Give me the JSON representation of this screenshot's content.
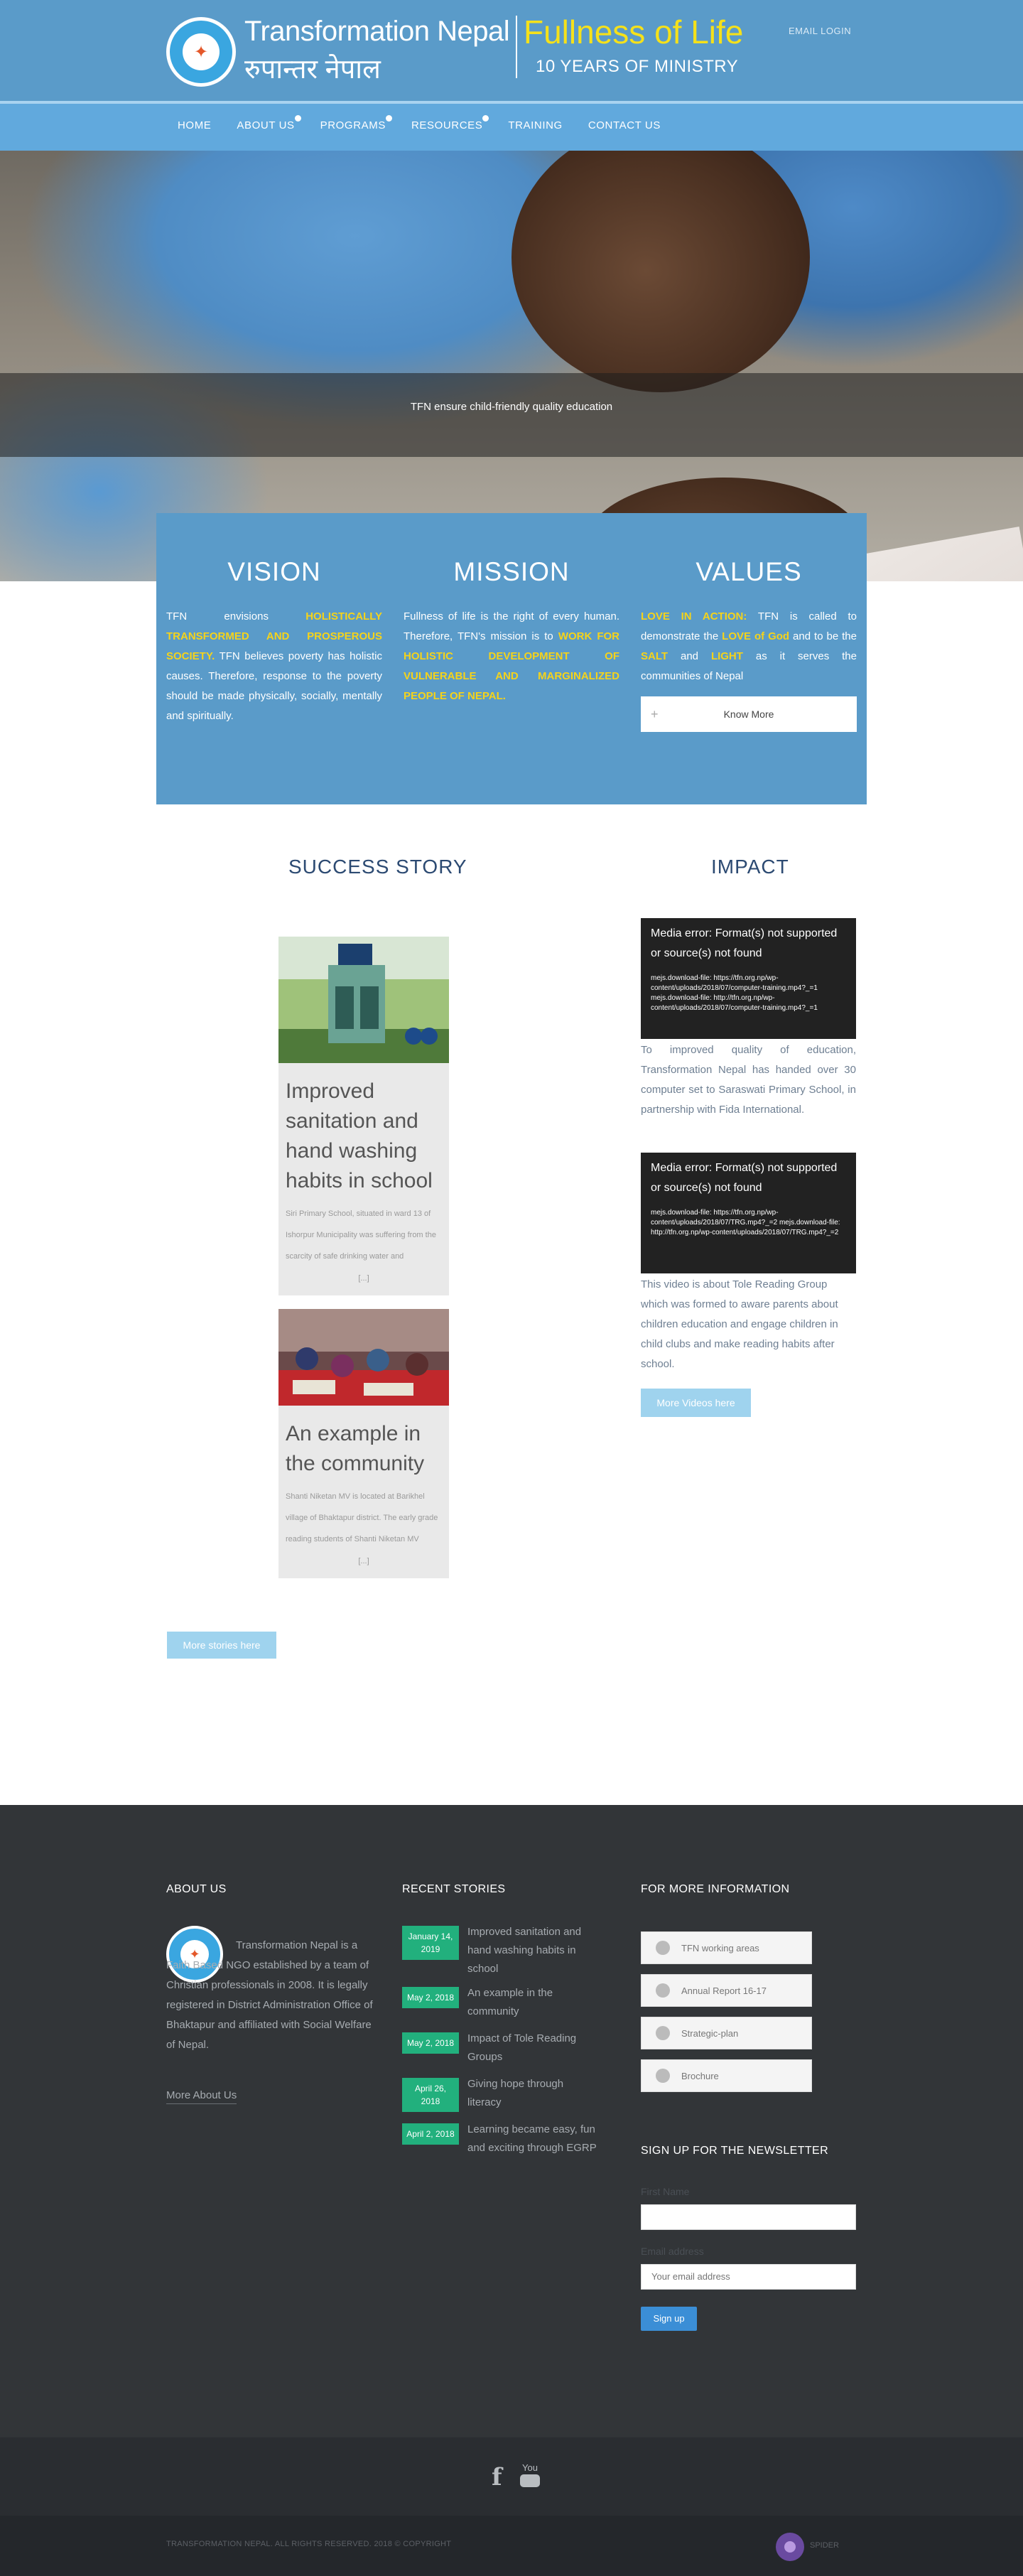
{
  "header": {
    "logo_text": "Transformation Nepal",
    "brand_name_en": "Transformation Nepal",
    "brand_name_np": "रुपान्तर नेपाल",
    "tagline": "Fullness of Life",
    "ministry": "10 YEARS OF MINISTRY",
    "email_login": "EMAIL LOGIN"
  },
  "nav": {
    "items": [
      {
        "label": "HOME"
      },
      {
        "label": "ABOUT US"
      },
      {
        "label": "PROGRAMS"
      },
      {
        "label": "RESOURCES"
      },
      {
        "label": "TRAINING"
      },
      {
        "label": "CONTACT US"
      }
    ]
  },
  "hero": {
    "caption": "TFN ensure child-friendly quality education"
  },
  "vmv": {
    "vision": {
      "title": "VISION",
      "t1": "TFN envisions ",
      "h1": "HOLISTICALLY TRANSFORMED AND PROSPEROUS SOCIETY.",
      "t2": " TFN believes poverty has holistic causes. Therefore, response to the poverty should be made physically, socially, mentally and spiritually."
    },
    "mission": {
      "title": "MISSION",
      "t1": "Fullness of life is the right of every human. Therefore, TFN's mission is to ",
      "h1": "WORK FOR HOLISTIC DEVELOPMENT OF VULNERABLE AND MARGINALIZED PEOPLE OF NEPAL."
    },
    "values": {
      "title": "VALUES",
      "h1": "LOVE IN ACTION:",
      "t1": " TFN is called to demonstrate the ",
      "h2": "LOVE of God",
      "t2": " and to be the ",
      "h3": "SALT",
      "t3": " and ",
      "h4": "LIGHT",
      "t4": " as it serves the communities of Nepal",
      "button": "Know More"
    }
  },
  "success": {
    "title": "SUCCESS STORY",
    "stories": [
      {
        "title": "Improved sanitation and hand washing habits in school",
        "excerpt": "Siri Primary School, situated in ward 13 of Ishorpur Municipality was suffering from the scarcity of safe drinking water and",
        "more": "[...]"
      },
      {
        "title": "An example in the community",
        "excerpt": "Shanti Niketan MV is located at Barikhel village of Bhaktapur district. The early grade reading students of Shanti Niketan MV",
        "more": "[...]"
      }
    ],
    "more_button": "More stories here"
  },
  "impact": {
    "title": "IMPACT",
    "videos": [
      {
        "error": "Media error: Format(s) not supported or source(s) not found",
        "detail": "mejs.download-file: https://tfn.org.np/wp-content/uploads/2018/07/computer-training.mp4?_=1 mejs.download-file: http://tfn.org.np/wp-content/uploads/2018/07/computer-training.mp4?_=1",
        "desc": "To improved quality of education, Transformation Nepal has handed over 30 computer set to Saraswati Primary School, in partnership with Fida International."
      },
      {
        "error": "Media error: Format(s) not supported or source(s) not found",
        "detail": "mejs.download-file: https://tfn.org.np/wp-content/uploads/2018/07/TRG.mp4?_=2 mejs.download-file: http://tfn.org.np/wp-content/uploads/2018/07/TRG.mp4?_=2",
        "desc": "This video is about Tole Reading Group which was formed to aware parents about children education and engage children in child clubs and make reading habits after school."
      }
    ],
    "more_button": "More Videos here"
  },
  "footer": {
    "about": {
      "title": "ABOUT US",
      "text": "Transformation Nepal is a Faith Based NGO established by a team of Christian professionals in 2008. It is legally registered in District Administration Office of Bhaktapur and affiliated with Social Welfare of Nepal.",
      "link": "More About Us"
    },
    "recent": {
      "title": "RECENT STORIES",
      "items": [
        {
          "date": "January 14, 2019",
          "title": "Improved sanitation and hand washing habits in school"
        },
        {
          "date": "May 2, 2018",
          "title": "An example in the community"
        },
        {
          "date": "May 2, 2018",
          "title": "Impact of Tole Reading Groups"
        },
        {
          "date": "April 26, 2018",
          "title": "Giving hope through literacy"
        },
        {
          "date": "April 2, 2018",
          "title": "Learning became easy, fun and exciting through EGRP"
        }
      ]
    },
    "info": {
      "title": "FOR MORE INFORMATION",
      "buttons": [
        {
          "label": "TFN working areas"
        },
        {
          "label": "Annual Report 16-17"
        },
        {
          "label": "Strategic-plan"
        },
        {
          "label": "Brochure"
        }
      ]
    },
    "newsletter": {
      "title": "SIGN UP FOR THE NEWSLETTER",
      "first_name_label": "First Name",
      "email_label": "Email address",
      "email_placeholder": "Your email address",
      "button": "Sign up"
    }
  },
  "bottom": {
    "copyright": "TRANSFORMATION NEPAL. ALL RIGHTS RESERVED. 2018 © COPYRIGHT",
    "brand": "SPIDER"
  },
  "colors": {
    "header_blue": "#5a9bc9",
    "highlight_yellow": "#f5d31a",
    "badge_green": "#22b07d",
    "footer_dark": "#323538"
  }
}
